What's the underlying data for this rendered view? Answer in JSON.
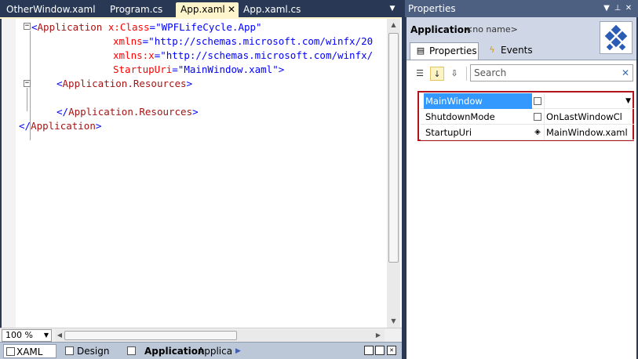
{
  "editor": {
    "tabs": [
      {
        "label": "OtherWindow.xaml"
      },
      {
        "label": "Program.cs"
      },
      {
        "label": "App.xaml",
        "close": "✕"
      },
      {
        "label": "App.xaml.cs"
      }
    ],
    "code": [
      {
        "p1": "<",
        "p2": "Application",
        "p3": " x:Class",
        "p4": "=\"",
        "p5": "WPFLifeCycle.App",
        "p6": "\""
      },
      {
        "p1": "",
        "p2": "",
        "p3": "xmlns",
        "p4": "=\"",
        "p5": "http://schemas.microsoft.com/winfx/20",
        "p6": ""
      },
      {
        "p1": "",
        "p2": "",
        "p3": "xmlns:x",
        "p4": "=\"",
        "p5": "http://schemas.microsoft.com/winfx/",
        "p6": ""
      },
      {
        "p1": "",
        "p2": "",
        "p3": "StartupUri",
        "p4": "=\"",
        "p5": "MainWindow.xaml",
        "p6": "\">"
      },
      {
        "p1": "<",
        "p2": "Application.Resources",
        "p3": "",
        "p4": "",
        "p5": "",
        "p6": ">"
      },
      {
        "p1": "",
        "p2": "",
        "p3": "",
        "p4": "",
        "p5": "",
        "p6": ""
      },
      {
        "p1": "</",
        "p2": "Application.Resources",
        "p3": "",
        "p4": "",
        "p5": "",
        "p6": ">"
      },
      {
        "p1": "</",
        "p2": "Application",
        "p3": "",
        "p4": "",
        "p5": "",
        "p6": ">"
      }
    ],
    "zoom": "100 %",
    "view_tabs": {
      "xaml": "XAML",
      "design": "Design"
    },
    "breadcrumb": {
      "element": "Application",
      "type": "Applica"
    }
  },
  "properties": {
    "title": "Properties",
    "object_name": "Application",
    "object_subtitle": "<no name>",
    "tabs": {
      "properties": "Properties",
      "events": "Events"
    },
    "search_placeholder": "Search",
    "rows": [
      {
        "name": "MainWindow",
        "value": ""
      },
      {
        "name": "ShutdownMode",
        "value": "OnLastWindowCl"
      },
      {
        "name": "StartupUri",
        "value": "MainWindow.xaml"
      }
    ]
  },
  "colors": {
    "frame": "#293955",
    "active_tab": "#fff5cc",
    "selection": "#3399ff",
    "highlight_border": "#b3141b"
  }
}
